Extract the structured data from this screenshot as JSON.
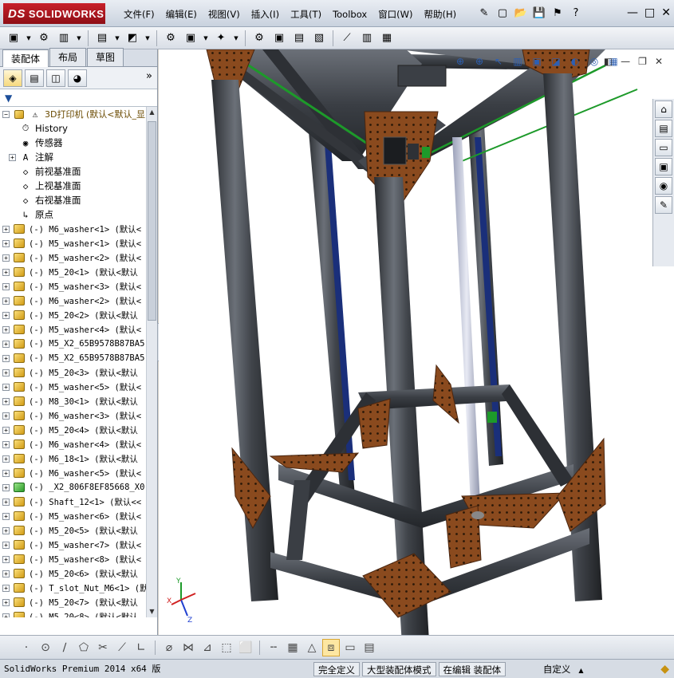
{
  "app": {
    "logo_ds": "DS",
    "logo_text": "SOLIDWORKS"
  },
  "menus": [
    "文件(F)",
    "编辑(E)",
    "视图(V)",
    "插入(I)",
    "工具(T)",
    "Toolbox",
    "窗口(W)",
    "帮助(H)"
  ],
  "quick_access": [
    "pin-icon",
    "new-icon",
    "open-icon",
    "save-icon",
    "rebuild-traffic-light-icon",
    "help-icon"
  ],
  "quick_access_glyphs": [
    "✎",
    "▢",
    "📂",
    "💾",
    "⚑",
    "?"
  ],
  "window_controls": [
    "—",
    "□",
    "✕"
  ],
  "panel": {
    "tabs": [
      "装配体",
      "布局",
      "草图"
    ],
    "active_tab": 0,
    "manager_icons": [
      "featuremanager-icon",
      "propertymanager-icon",
      "configurationmanager-icon",
      "displaymanager-icon"
    ],
    "more_glyph": "»",
    "filter_glyph": "▼"
  },
  "tree": {
    "root": {
      "label": "3D打印机  (默认<默认_显"
    },
    "features": [
      {
        "label": "History",
        "icon": "history-icon",
        "glyph": "⏱",
        "expand": false
      },
      {
        "label": "传感器",
        "icon": "sensor-icon",
        "glyph": "◉",
        "expand": false
      },
      {
        "label": "注解",
        "icon": "annotation-icon",
        "glyph": "A",
        "expand": true
      },
      {
        "label": "前视基准面",
        "icon": "plane-icon",
        "glyph": "◇",
        "expand": false
      },
      {
        "label": "上视基准面",
        "icon": "plane-icon",
        "glyph": "◇",
        "expand": false
      },
      {
        "label": "右视基准面",
        "icon": "plane-icon",
        "glyph": "◇",
        "expand": false
      },
      {
        "label": "原点",
        "icon": "origin-icon",
        "glyph": "↳",
        "expand": false
      }
    ],
    "components": [
      "(-) M6_washer<1> (默认<",
      "(-) M5_washer<1> (默认<",
      "(-) M5_washer<2> (默认<",
      "(-) M5_20<1> (默认<默认",
      "(-) M5_washer<3> (默认<",
      "(-) M6_washer<2> (默认<",
      "(-) M5_20<2> (默认<默认",
      "(-) M5_washer<4> (默认<",
      "(-) M5_X2_65B9578B87BA5",
      "(-) M5_X2_65B9578B87BA5",
      "(-) M5_20<3> (默认<默认",
      "(-) M5_washer<5> (默认<",
      "(-) M8_30<1> (默认<默认",
      "(-) M6_washer<3> (默认<",
      "(-) M5_20<4> (默认<默认",
      "(-) M6_washer<4> (默认<",
      "(-) M6_18<1> (默认<默认",
      "(-) M6_washer<5> (默认<",
      "(-) _X2_806F8EF85668_X0",
      "(-) Shaft_12<1> (默认<<",
      "(-) M5_washer<6> (默认<",
      "(-) M5_20<5> (默认<默认",
      "(-) M5_washer<7> (默认<",
      "(-) M5_washer<8> (默认<",
      "(-) M5_20<6> (默认<默认",
      "(-) T_slot_Nut_M6<1> (默",
      "(-) M5_20<7> (默认<默认",
      "(-) M5_20<8> (默认<默认"
    ],
    "special_component_index": 18
  },
  "viewport": {
    "headsup_icons": [
      "zoom-to-fit-icon",
      "zoom-area-icon",
      "previous-view-icon",
      "section-view-icon",
      "view-orientation-icon",
      "display-style-icon",
      "hide-show-icon",
      "edit-appearance-icon",
      "apply-scene-icon"
    ],
    "headsup_glyphs": [
      "⊕",
      "⊕",
      "↖",
      "▥",
      "▣",
      "◪",
      "◐",
      "◎",
      "▦"
    ],
    "doc_controls": [
      "◧",
      "—",
      "❐",
      "✕"
    ],
    "taskpane_icons": [
      "home-icon",
      "resources-icon",
      "design-library-icon",
      "file-explorer-icon",
      "appearances-icon",
      "custom-properties-icon"
    ],
    "taskpane_glyphs": [
      "⌂",
      "▤",
      "▭",
      "▣",
      "◉",
      "✎"
    ],
    "triad": {
      "x": "X",
      "y": "Y",
      "z": "Z"
    }
  },
  "sketch_toolbar": {
    "groups": [
      [
        "point-icon",
        "circle-icon",
        "line-icon",
        "polygon-icon",
        "trim-icon",
        "line-slash-icon",
        "corner-icon"
      ],
      [
        "smart-dimension-icon",
        "mirror-icon",
        "offset-icon",
        "corner-rectangle-icon",
        "rectangle-dashed-icon"
      ],
      [
        "centerline-icon",
        "grid-icon",
        "triangle-icon",
        "view-cube-icon",
        "window-icon",
        "tile-icon"
      ]
    ],
    "glyphs": [
      [
        "·",
        "⊙",
        "∕",
        "⬠",
        "✂",
        "⟋",
        "∟"
      ],
      [
        "⌀",
        "⋈",
        "⊿",
        "⬚",
        "⬜"
      ],
      [
        "╌",
        "▦",
        "△",
        "⧈",
        "▭",
        "▤"
      ]
    ],
    "active": "view-cube-icon"
  },
  "status": {
    "app_version": "SolidWorks Premium 2014 x64 版",
    "fully_defined": "完全定义",
    "large_assembly": "大型装配体模式",
    "editing": "在编辑 装配体",
    "custom": "自定义",
    "custom_dropdown": "▲",
    "help_glyph": "◆"
  },
  "colors": {
    "accent": "#c8202a",
    "frame": "#3d4147",
    "plate": "#8a4a1e",
    "belt": "#1d9a2a"
  }
}
